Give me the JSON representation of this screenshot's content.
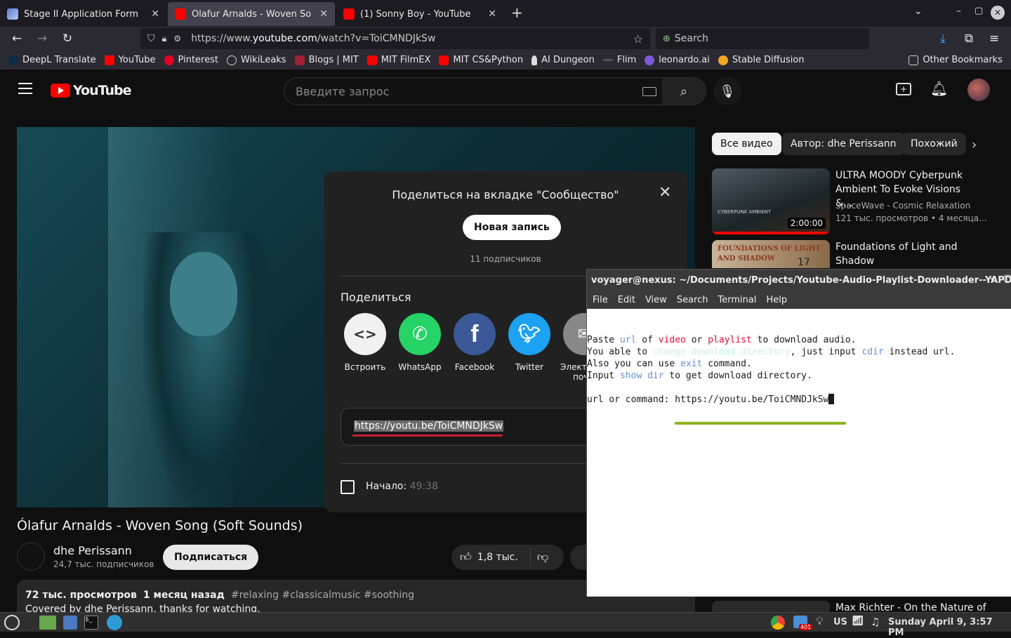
{
  "browser": {
    "tabs": [
      {
        "label": "Stage II Application Form",
        "close": "✕"
      },
      {
        "label": "Ólafur Arnalds - Woven Song",
        "close": "✕"
      },
      {
        "label": "(1) Sonny Boy - YouTube",
        "close": "✕"
      }
    ],
    "new_tab": "+",
    "url_prefix": "https://www.",
    "url_domain": "youtube.com",
    "url_path": "/watch?v=ToiCMNDJkSw",
    "search_placeholder": "Search",
    "bookmarks": [
      {
        "label": "DeepL Translate",
        "color": "#0f2b46"
      },
      {
        "label": "YouTube",
        "color": "#ff0000"
      },
      {
        "label": "Pinterest",
        "color": "#e60023"
      },
      {
        "label": "WikiLeaks",
        "color": "#888888"
      },
      {
        "label": "Blogs | MIT",
        "color": "#a31f34"
      },
      {
        "label": "MIT FilmEX",
        "color": "#ff0000"
      },
      {
        "label": "MIT CS&Python",
        "color": "#ff0000"
      },
      {
        "label": "AI Dungeon",
        "color": "#dddddd"
      },
      {
        "label": "Flim",
        "color": "#555555"
      },
      {
        "label": "leonardo.ai",
        "color": "#7b5cd6"
      },
      {
        "label": "Stable Diffusion",
        "color": "#f5a623"
      }
    ],
    "other_bookmarks": "Other Bookmarks"
  },
  "youtube": {
    "logo_text": "YouTube",
    "search_placeholder": "Введите запрос",
    "video_title": "Ólafur Arnalds - Woven Song (Soft Sounds)",
    "channel_name": "dhe Perissann",
    "subscribers": "24,7 тыс. подписчиков",
    "subscribe_label": "Подписаться",
    "likes": "1,8 тыс.",
    "views": "72 тыс. просмотров",
    "date": "1 месяц назад",
    "tags": "#relaxing #classicalmusic #soothing",
    "description": "Covered by dhe Perissann, thanks for watching.",
    "chips": [
      "Все видео",
      "Автор: dhe Perissann",
      "Похожий"
    ],
    "recommendations": [
      {
        "title": "ULTRA MOODY Cyberpunk Ambient To Evoke Visions &...",
        "channel": "SpaceWave - Cosmic Relaxation",
        "meta": "121 тыс. просмотров • 4 месяца...",
        "duration": "2:00:00",
        "thumb_text": "CYBERPUNK AMBIENT"
      },
      {
        "title": "Foundations of Light and Shadow",
        "thumb_text": "FOUNDATIONS OF LIGHT AND SHADOW",
        "thumb_num": "17"
      },
      {
        "title": "Max Richter - On the Nature of"
      }
    ]
  },
  "share_dialog": {
    "title": "Поделиться на вкладке \"Сообщество\"",
    "new_post": "Новая запись",
    "subscribers": "11 подписчиков",
    "share_label": "Поделиться",
    "options": [
      {
        "label": "Встроить"
      },
      {
        "label": "WhatsApp"
      },
      {
        "label": "Facebook"
      },
      {
        "label": "Twitter"
      },
      {
        "label": "Электр",
        "label2": "поч"
      }
    ],
    "link": "https://youtu.be/ToiCMNDJkSw",
    "start_label": "Начало:",
    "start_time": "49:38"
  },
  "terminal": {
    "title": "voyager@nexus: ~/Documents/Projects/Youtube-Audio-Playlist-Downloader--YAPD--m...",
    "menu": [
      "File",
      "Edit",
      "View",
      "Search",
      "Terminal",
      "Help"
    ],
    "lines": [
      [
        {
          "t": "Paste "
        },
        {
          "t": "url",
          "c": "#6a8fd8"
        },
        {
          "t": " of "
        },
        {
          "t": "video",
          "c": "#e0103a"
        },
        {
          "t": " or "
        },
        {
          "t": "playlist",
          "c": "#e0103a"
        },
        {
          "t": " to download audio."
        }
      ],
      [
        {
          "t": "You able to "
        },
        {
          "t": "change download directory",
          "c": "#c8f0f0"
        },
        {
          "t": ", just input "
        },
        {
          "t": "cdir",
          "c": "#6a8fd8"
        },
        {
          "t": " instead url."
        }
      ],
      [
        {
          "t": "Also you can use "
        },
        {
          "t": "exit",
          "c": "#6a8fd8"
        },
        {
          "t": " command."
        }
      ],
      [
        {
          "t": "Input "
        },
        {
          "t": "show dir",
          "c": "#6a8fd8"
        },
        {
          "t": " to get download directory."
        }
      ],
      [
        {
          "t": " "
        }
      ],
      [
        {
          "t": "url or command: "
        },
        {
          "t": "https://youtu.be/ToiCMNDJkSw"
        }
      ]
    ]
  },
  "taskbar": {
    "keyboard_layout": "US",
    "badge": "401",
    "datetime": "Sunday April 9, 3:57 PM"
  }
}
